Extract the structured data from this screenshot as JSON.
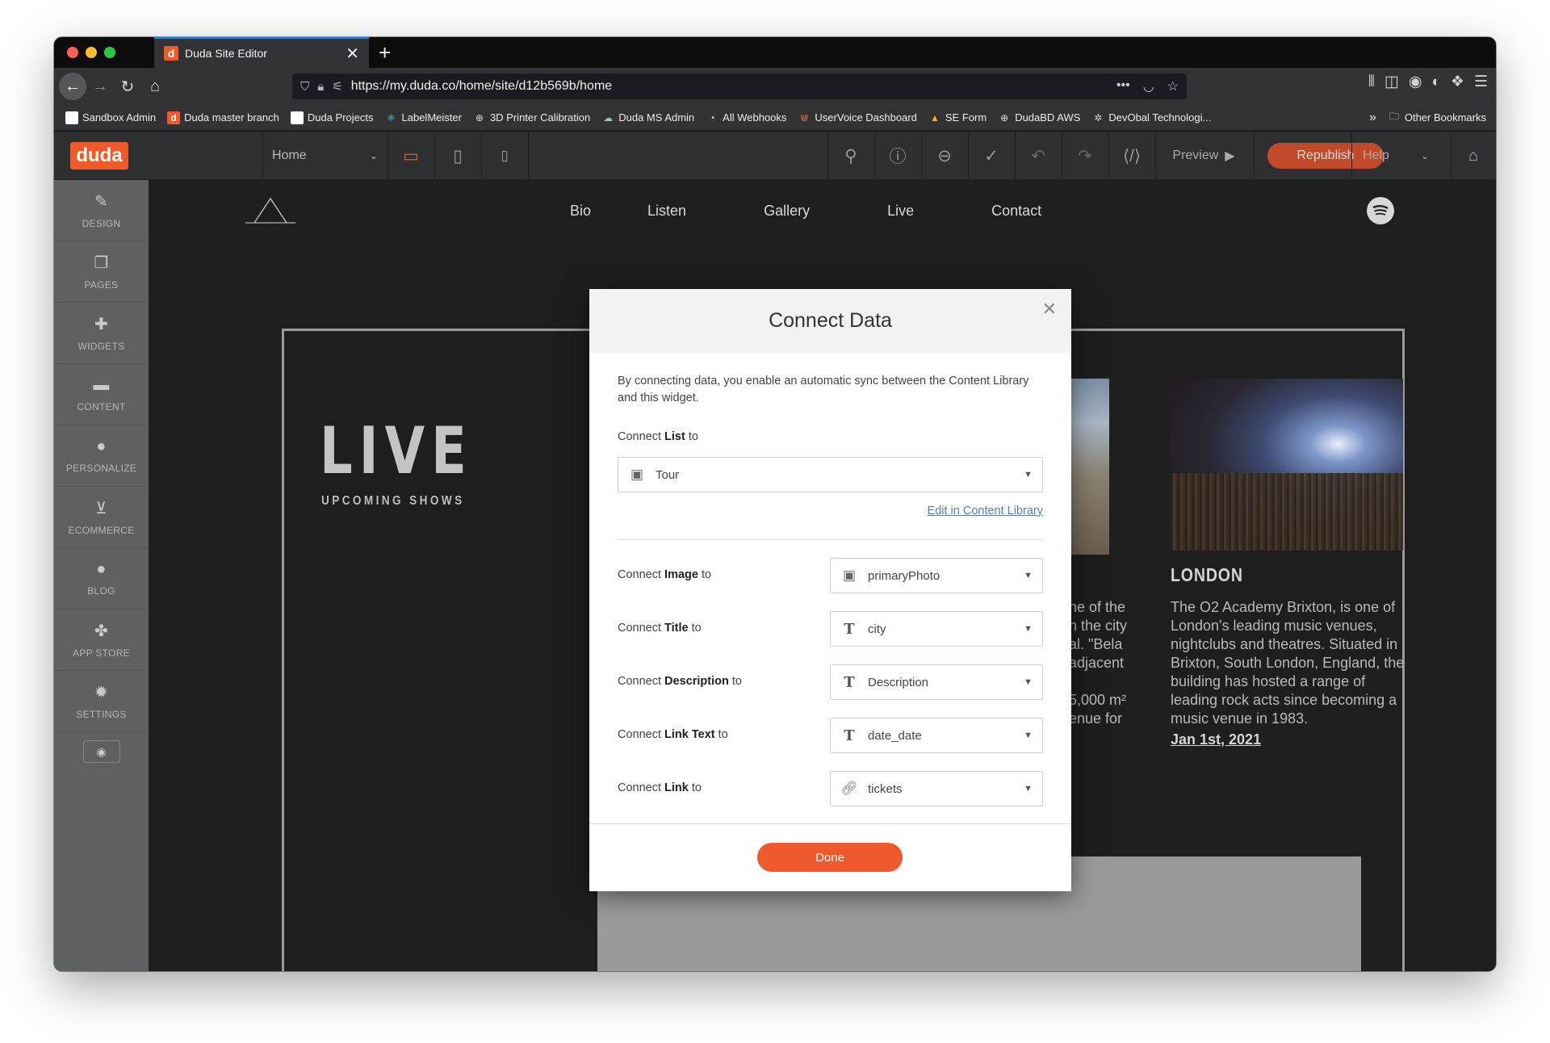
{
  "browser": {
    "tab_title": "Duda Site Editor",
    "tab_favicon": "d",
    "url": "https://my.duda.co/home/site/d12b569b/home",
    "bookmarks": [
      {
        "label": "Sandbox Admin",
        "icon": "page-icon"
      },
      {
        "label": "Duda master branch",
        "icon": "duda-icon"
      },
      {
        "label": "Duda Projects",
        "icon": "page-icon"
      },
      {
        "label": "LabelMeister",
        "icon": "react-icon"
      },
      {
        "label": "3D Printer Calibration",
        "icon": "globe-icon"
      },
      {
        "label": "Duda MS Admin",
        "icon": "cloud-icon"
      },
      {
        "label": "All Webhooks",
        "icon": "webhook-icon"
      },
      {
        "label": "UserVoice Dashboard",
        "icon": "uservoice-icon"
      },
      {
        "label": "SE Form",
        "icon": "drive-icon"
      },
      {
        "label": "DudaBD AWS",
        "icon": "globe-icon"
      },
      {
        "label": "DevObal Technologi...",
        "icon": "gear-icon"
      }
    ],
    "other_bookmarks": "Other Bookmarks"
  },
  "editor": {
    "logo": "duda",
    "page_select": "Home",
    "preview": "Preview",
    "republish": "Republish",
    "help": "Help",
    "accent": "#f05a28"
  },
  "sidebar": {
    "items": [
      {
        "label": "DESIGN",
        "icon": "brush-icon"
      },
      {
        "label": "PAGES",
        "icon": "pages-icon"
      },
      {
        "label": "WIDGETS",
        "icon": "plus-icon"
      },
      {
        "label": "CONTENT",
        "icon": "folder-icon"
      },
      {
        "label": "PERSONALIZE",
        "icon": "person-icon"
      },
      {
        "label": "ECOMMERCE",
        "icon": "cart-icon"
      },
      {
        "label": "BLOG",
        "icon": "chat-icon"
      },
      {
        "label": "APP STORE",
        "icon": "puzzle-icon"
      },
      {
        "label": "SETTINGS",
        "icon": "gear-icon"
      }
    ]
  },
  "site": {
    "nav": [
      "Bio",
      "Listen",
      "Gallery",
      "Live",
      "Contact"
    ],
    "hero_title": "LIVE",
    "hero_subtitle": "UPCOMING SHOWS",
    "middle_card_text": [
      "ne of the",
      "n the city",
      "al. \"Bela",
      "adjacent",
      "",
      "5,000 m²",
      "enue for"
    ],
    "card_title": "LONDON",
    "card_text": "The O2 Academy Brixton, is one of London's leading music venues, nightclubs and theatres. Situated in Brixton, South London, England, the building has hosted a range of leading rock acts since becoming a music venue in 1983.",
    "card_date": "Jan 1st, 2021"
  },
  "modal": {
    "title": "Connect Data",
    "intro": "By connecting data, you enable an automatic sync between the Content Library and this widget.",
    "list_label_pre": "Connect ",
    "list_label_bold": "List",
    "list_label_post": " to",
    "list_value": "Tour",
    "edit_link": "Edit in Content Library",
    "fields": [
      {
        "pre": "Connect ",
        "bold": "Image",
        "post": " to",
        "value": "primaryPhoto",
        "icon": "image-icon"
      },
      {
        "pre": "Connect ",
        "bold": "Title",
        "post": " to",
        "value": "city",
        "icon": "text-icon"
      },
      {
        "pre": "Connect ",
        "bold": "Description",
        "post": " to",
        "value": "Description",
        "icon": "text-icon"
      },
      {
        "pre": "Connect ",
        "bold": "Link Text",
        "post": " to",
        "value": "date_date",
        "icon": "text-icon"
      },
      {
        "pre": "Connect ",
        "bold": "Link",
        "post": " to",
        "value": "tickets",
        "icon": "link-icon"
      }
    ],
    "done": "Done"
  }
}
